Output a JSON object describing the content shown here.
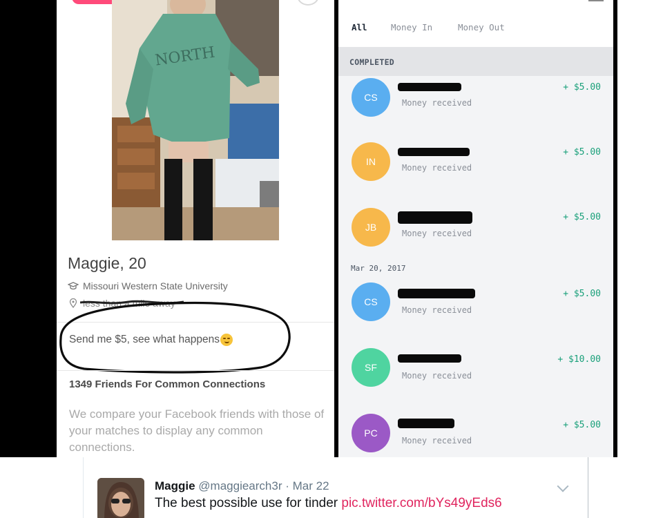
{
  "profile": {
    "name_age": "Maggie, 20",
    "school": "Missouri Western State University",
    "distance": "less than a mile away",
    "bio": "Send me $5, see what happens",
    "bio_emoji": "smirk-emoji",
    "friends_title": "1349 Friends For Common Connections",
    "friends_body": "We compare your Facebook friends with those of your matches to display any common connections."
  },
  "wallet": {
    "tabs": [
      "All",
      "Money In",
      "Money Out"
    ],
    "section_label": "COMPLETED",
    "date_label": "Mar 20, 2017",
    "transactions": [
      {
        "initials": "CS",
        "label": "Money received",
        "amount": "+ $5.00",
        "color": "#5aaef0"
      },
      {
        "initials": "IN",
        "label": "Money received",
        "amount": "+ $5.00",
        "color": "#f7b84b"
      },
      {
        "initials": "JB",
        "label": "Money received",
        "amount": "+ $5.00",
        "color": "#f7b84b"
      },
      {
        "initials": "CS",
        "label": "Money received",
        "amount": "+ $5.00",
        "color": "#5aaef0"
      },
      {
        "initials": "SF",
        "label": "Money received",
        "amount": "+ $10.00",
        "color": "#4fd4a0"
      },
      {
        "initials": "PC",
        "label": "Money received",
        "amount": "+ $5.00",
        "color": "#9b59c6"
      }
    ],
    "colors": {
      "amount": "#1aa07a"
    }
  },
  "tweet": {
    "name": "Maggie",
    "handle": "@maggiearch3r",
    "sep": "·",
    "date": "Mar 22",
    "text": "The best possible use for tinder",
    "link": "pic.twitter.com/bYs49yEds6"
  }
}
